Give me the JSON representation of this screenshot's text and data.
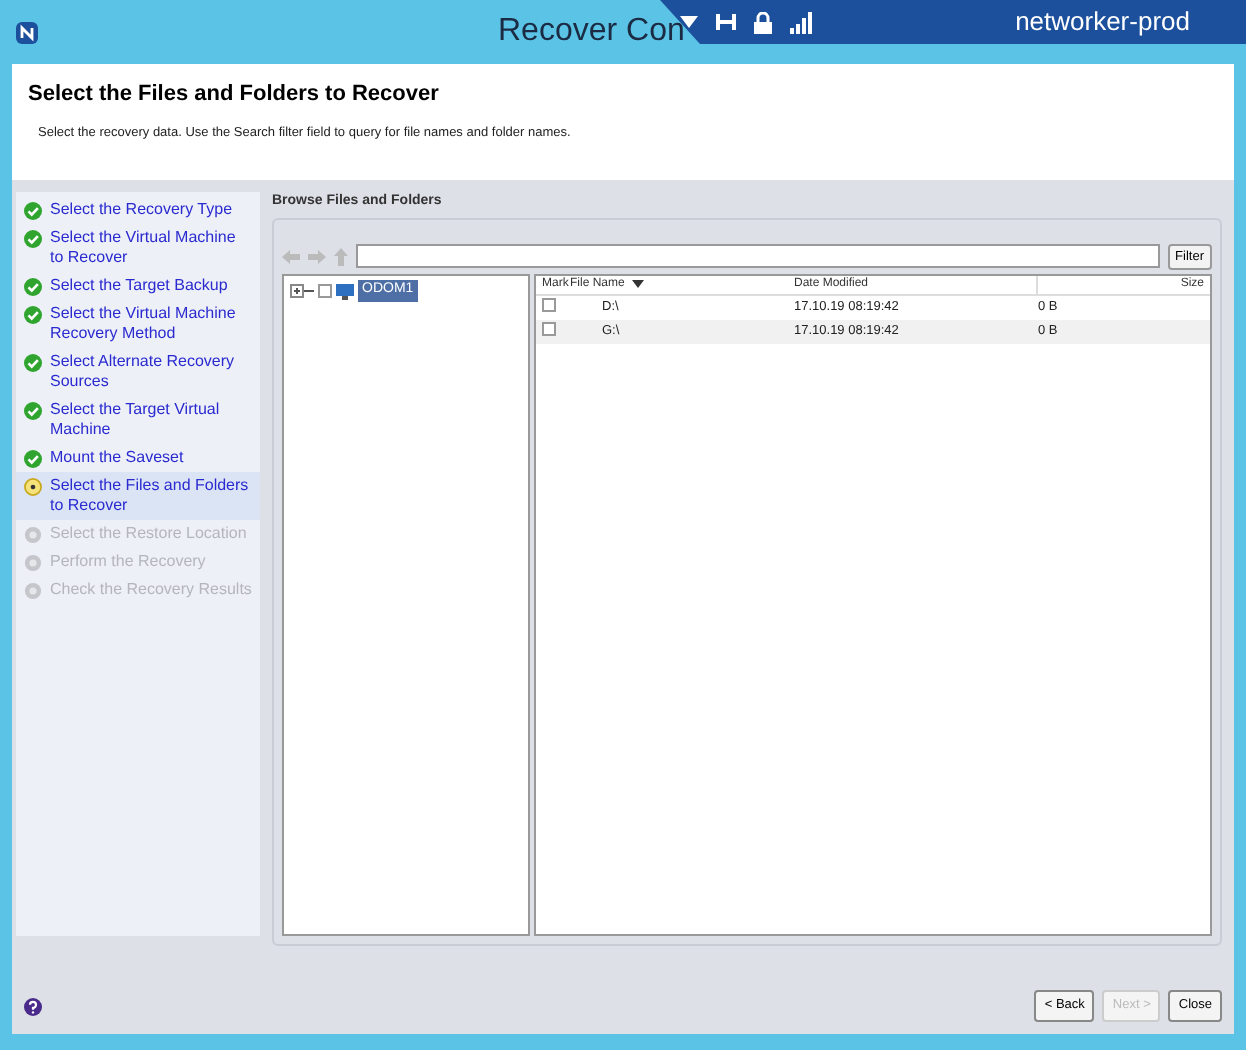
{
  "window": {
    "title": "Recover Con"
  },
  "rdp_bar": {
    "host": "networker-prod"
  },
  "header": {
    "title": "Select the Files and Folders to Recover",
    "description": "Select the recovery data. Use the Search filter field to query for file names and folder names."
  },
  "steps": [
    {
      "label": "Select the Recovery Type",
      "completed": true,
      "selected": false
    },
    {
      "label": "Select the Virtual Machine to Recover",
      "completed": true,
      "selected": false
    },
    {
      "label": "Select the Target Backup",
      "completed": true,
      "selected": false
    },
    {
      "label": "Select the Virtual Machine Recovery Method",
      "completed": true,
      "selected": false
    },
    {
      "label": "Select Alternate Recovery Sources",
      "completed": true,
      "selected": false
    },
    {
      "label": "Select the Target Virtual Machine",
      "completed": true,
      "selected": false
    },
    {
      "label": "Mount the Saveset",
      "completed": true,
      "selected": false
    },
    {
      "label": "Select the Files and Folders to Recover",
      "completed": false,
      "selected": true
    },
    {
      "label": "Select the Restore Location",
      "completed": false,
      "selected": false
    },
    {
      "label": "Perform the Recovery",
      "completed": false,
      "selected": false
    },
    {
      "label": "Check the Recovery Results",
      "completed": false,
      "selected": false
    }
  ],
  "browse": {
    "title": "Browse Files and Folders",
    "filter_button": "Filter",
    "tree": [
      {
        "label": "ODOM1",
        "selected": true,
        "checked": false,
        "expanded": false
      }
    ],
    "table": {
      "columns": [
        "Mark",
        "File Name",
        "Date Modified",
        "Size"
      ],
      "rows": [
        {
          "checked": false,
          "name": "D:\\",
          "date": "17.10.19 08:19:42",
          "size": "0 B"
        },
        {
          "checked": false,
          "name": "G:\\",
          "date": "17.10.19 08:19:42",
          "size": "0 B"
        }
      ]
    }
  },
  "buttons": [
    {
      "label": "< Back",
      "disabled": false
    },
    {
      "label": "Next >",
      "disabled": true
    },
    {
      "label": "Close",
      "disabled": false
    }
  ]
}
